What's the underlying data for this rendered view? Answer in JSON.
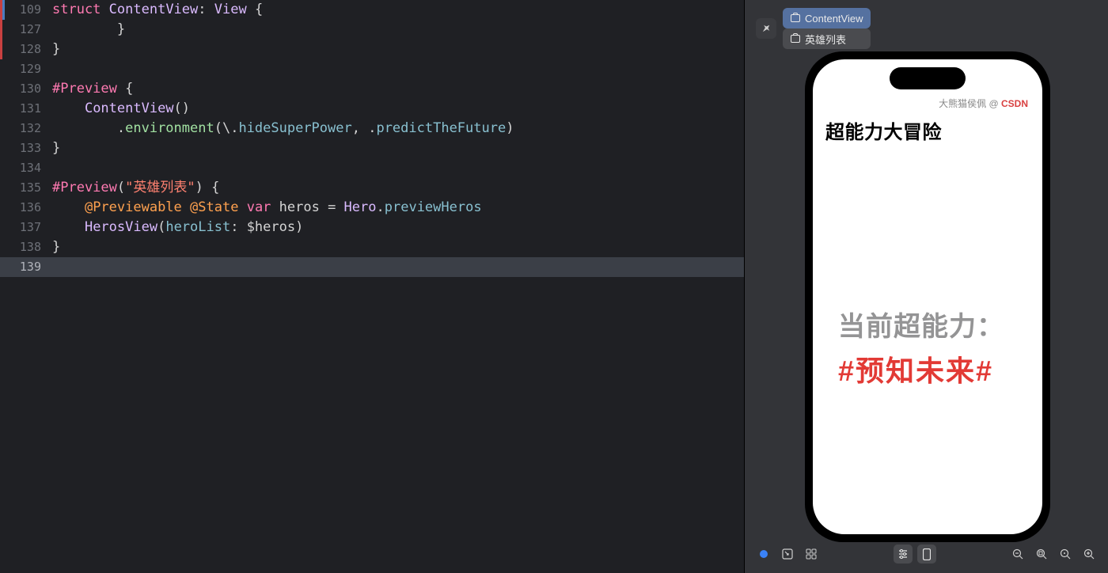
{
  "editor": {
    "lines": [
      {
        "num": "109",
        "segs": [
          {
            "t": "struct",
            "c": "kw"
          },
          {
            "t": " "
          },
          {
            "t": "ContentView",
            "c": "type"
          },
          {
            "t": ": "
          },
          {
            "t": "View",
            "c": "type"
          },
          {
            "t": " {"
          }
        ]
      },
      {
        "num": "127",
        "segs": [
          {
            "t": "        }"
          }
        ]
      },
      {
        "num": "128",
        "segs": [
          {
            "t": "}"
          }
        ]
      },
      {
        "num": "129",
        "segs": []
      },
      {
        "num": "130",
        "segs": [
          {
            "t": "#Preview",
            "c": "kw"
          },
          {
            "t": " {"
          }
        ]
      },
      {
        "num": "131",
        "segs": [
          {
            "t": "    "
          },
          {
            "t": "ContentView",
            "c": "type"
          },
          {
            "t": "()"
          }
        ]
      },
      {
        "num": "132",
        "segs": [
          {
            "t": "        ."
          },
          {
            "t": "environment",
            "c": "fn"
          },
          {
            "t": "(\\."
          },
          {
            "t": "hideSuperPower",
            "c": "prop"
          },
          {
            "t": ", ."
          },
          {
            "t": "predictTheFuture",
            "c": "prop"
          },
          {
            "t": ")"
          }
        ]
      },
      {
        "num": "133",
        "segs": [
          {
            "t": "}"
          }
        ]
      },
      {
        "num": "134",
        "segs": []
      },
      {
        "num": "135",
        "segs": [
          {
            "t": "#Preview",
            "c": "kw"
          },
          {
            "t": "("
          },
          {
            "t": "\"英雄列表\"",
            "c": "str"
          },
          {
            "t": ") {"
          }
        ]
      },
      {
        "num": "136",
        "segs": [
          {
            "t": "    "
          },
          {
            "t": "@Previewable",
            "c": "decor"
          },
          {
            "t": " "
          },
          {
            "t": "@State",
            "c": "decor"
          },
          {
            "t": " "
          },
          {
            "t": "var",
            "c": "kw"
          },
          {
            "t": " heros = "
          },
          {
            "t": "Hero",
            "c": "type"
          },
          {
            "t": "."
          },
          {
            "t": "previewHeros",
            "c": "prop"
          }
        ]
      },
      {
        "num": "137",
        "segs": [
          {
            "t": "    "
          },
          {
            "t": "HerosView",
            "c": "type"
          },
          {
            "t": "("
          },
          {
            "t": "heroList",
            "c": "prop"
          },
          {
            "t": ": $heros)"
          }
        ]
      },
      {
        "num": "138",
        "segs": [
          {
            "t": "}"
          }
        ]
      },
      {
        "num": "139",
        "segs": [],
        "hl": true
      }
    ],
    "markers": {
      "red": {
        "top": 0,
        "height": 75
      },
      "blue": {
        "top": 0,
        "height": 25
      }
    }
  },
  "preview": {
    "tabs": [
      {
        "label": "ContentView",
        "active": true
      },
      {
        "label": "英雄列表",
        "active": false
      }
    ],
    "phone": {
      "watermark_prefix": "大熊猫侯佩 @ ",
      "watermark_brand": "CSDN",
      "title": "超能力大冒险",
      "line1": "当前超能力：",
      "line2": "#预知未来#"
    }
  }
}
